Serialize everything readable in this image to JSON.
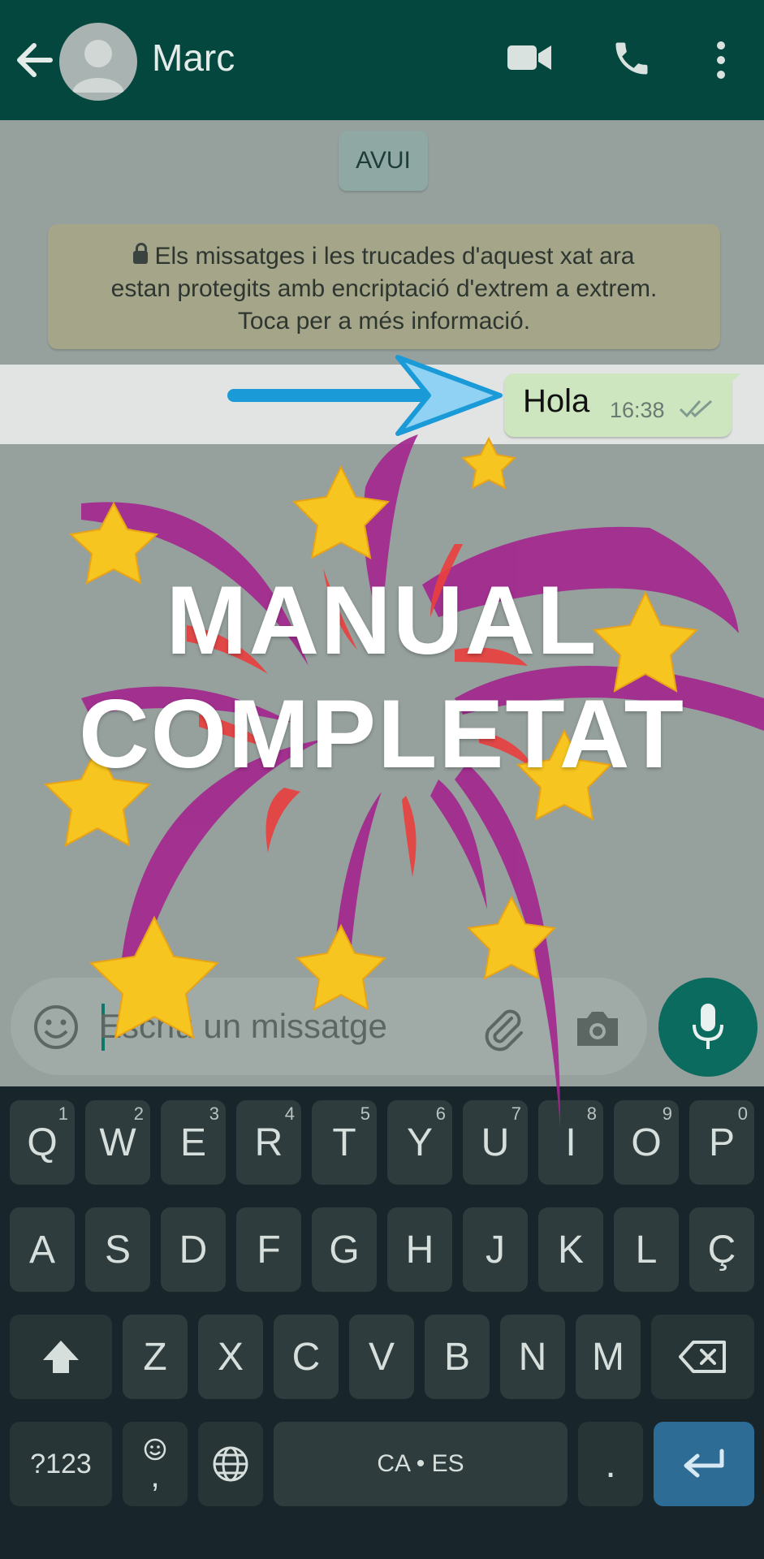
{
  "header": {
    "contact_name": "Marc",
    "icons": [
      "back-arrow-icon",
      "avatar-icon",
      "video-call-icon",
      "phone-icon",
      "more-vert-icon"
    ]
  },
  "chat": {
    "date_chip": "AVUI",
    "encryption_notice": {
      "line1": "Els missatges i les trucades d'aquest xat ara",
      "line2": "estan protegits amb encriptació d'extrem a extrem.",
      "line3": "Toca per a més informació."
    },
    "message": {
      "text": "Hola",
      "time": "16:38",
      "status": "read"
    }
  },
  "input": {
    "placeholder": "Escriu un missatge",
    "icons": [
      "emoji-icon",
      "attach-icon",
      "camera-icon",
      "mic-icon"
    ]
  },
  "overlay": {
    "line1": "MANUAL",
    "line2": "COMPLETAT"
  },
  "keyboard": {
    "row1": [
      "Q",
      "W",
      "E",
      "R",
      "T",
      "Y",
      "U",
      "I",
      "O",
      "P"
    ],
    "row1_hints": [
      "1",
      "2",
      "3",
      "4",
      "5",
      "6",
      "7",
      "8",
      "9",
      "0"
    ],
    "row2": [
      "A",
      "S",
      "D",
      "F",
      "G",
      "H",
      "J",
      "K",
      "L",
      "Ç"
    ],
    "row3": [
      "Z",
      "X",
      "C",
      "V",
      "B",
      "N",
      "M"
    ],
    "symbols_key": "?123",
    "comma_key": ",",
    "space_key": "CA • ES",
    "period_key": "."
  },
  "colors": {
    "header_bg": "#03473e",
    "chat_bg": "#96a19d",
    "bubble_bg": "#cde6bf",
    "mic_btn": "#0c6b5f",
    "arrow": "#1b9ad8",
    "firework_purple": "#a3278e",
    "firework_red": "#e8403f",
    "star": "#f6c51f"
  }
}
